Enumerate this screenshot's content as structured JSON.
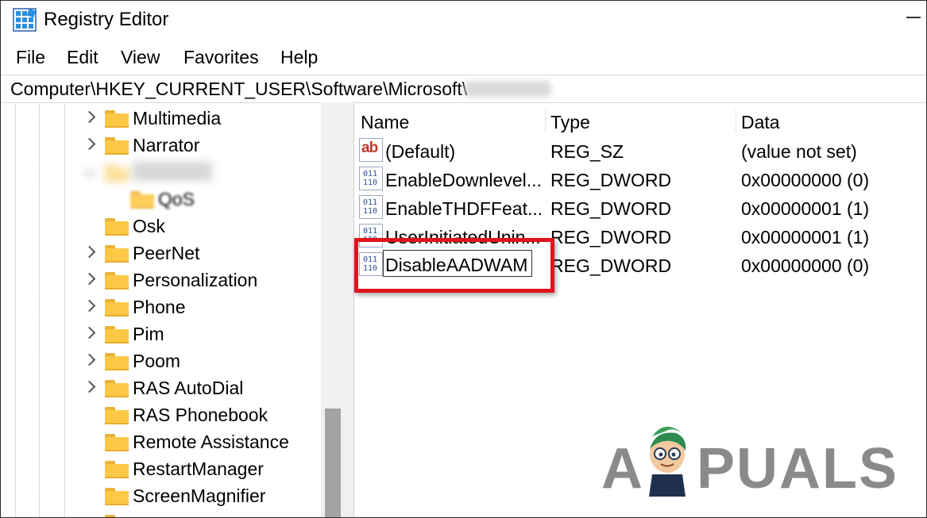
{
  "window": {
    "title": "Registry Editor"
  },
  "menu": {
    "items": [
      "File",
      "Edit",
      "View",
      "Favorites",
      "Help"
    ]
  },
  "address": {
    "path": "Computer\\HKEY_CURRENT_USER\\Software\\Microsoft\\"
  },
  "tree": {
    "items": [
      {
        "label": "Multimedia"
      },
      {
        "label": "Narrator"
      },
      {
        "label": ""
      },
      {
        "label": "QoS"
      },
      {
        "label": "Osk"
      },
      {
        "label": "PeerNet"
      },
      {
        "label": "Personalization"
      },
      {
        "label": "Phone"
      },
      {
        "label": "Pim"
      },
      {
        "label": "Poom"
      },
      {
        "label": "RAS AutoDial"
      },
      {
        "label": "RAS Phonebook"
      },
      {
        "label": "Remote Assistance"
      },
      {
        "label": "RestartManager"
      },
      {
        "label": "ScreenMagnifier"
      }
    ]
  },
  "list": {
    "columns": [
      "Name",
      "Type",
      "Data"
    ],
    "rows": [
      {
        "icon": "string-value-icon",
        "name": "(Default)",
        "type": "REG_SZ",
        "data": "(value not set)"
      },
      {
        "icon": "dword-value-icon",
        "name": "EnableDownlevel...",
        "type": "REG_DWORD",
        "data": "0x00000000 (0)"
      },
      {
        "icon": "dword-value-icon",
        "name": "EnableTHDFFeat...",
        "type": "REG_DWORD",
        "data": "0x00000001 (1)"
      },
      {
        "icon": "dword-value-icon",
        "name": "UserInitiatedUnin...",
        "type": "REG_DWORD",
        "data": "0x00000001 (1)"
      },
      {
        "icon": "dword-value-icon",
        "name": "DisableAADWAM",
        "type": "REG_DWORD",
        "data": "0x00000000 (0)"
      }
    ]
  },
  "icons": {
    "ab": "ab",
    "dword_line1": "011",
    "dword_line2": "110"
  },
  "watermark": {
    "left": "A",
    "right": "PUALS"
  },
  "colors": {
    "highlight": "#e0141e",
    "folder": "#fcc846",
    "watermark": "#8a8a8a"
  }
}
